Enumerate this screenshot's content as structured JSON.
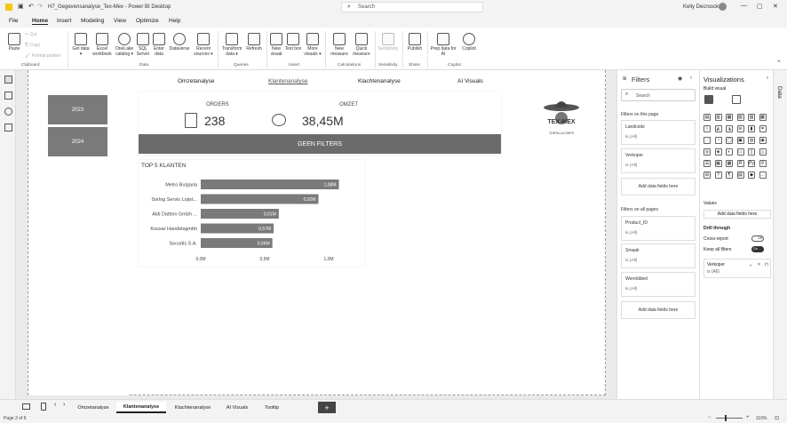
{
  "window": {
    "title": "H7_Gegevensanalyse_Tex-Mex - Power BI Desktop",
    "search_placeholder": "Search",
    "user": "Kelly Decroock"
  },
  "menu": [
    "File",
    "Home",
    "Insert",
    "Modeling",
    "View",
    "Optimize",
    "Help"
  ],
  "ribbon": {
    "clipboard": {
      "paste": "Paste",
      "cut": "Cut",
      "copy": "Copy",
      "format_painter": "Format painter",
      "group": "Clipboard"
    },
    "data": {
      "get_data": "Get data",
      "excel": "Excel workbook",
      "onelake": "OneLake catalog",
      "sql": "SQL Server",
      "enter": "Enter data",
      "dataverse": "Dataverse",
      "recent": "Recent sources",
      "group": "Data"
    },
    "queries": {
      "transform": "Transform data",
      "refresh": "Refresh",
      "group": "Queries"
    },
    "insert": {
      "new_visual": "New visual",
      "text_box": "Text box",
      "more_visuals": "More visuals",
      "group": "Insert"
    },
    "calculations": {
      "new_measure": "New measure",
      "quick_measure": "Quick measure",
      "group": "Calculations"
    },
    "sensitivity": {
      "label": "Sensitivity",
      "group": "Sensitivity"
    },
    "share": {
      "publish": "Publish",
      "group": "Share"
    },
    "copilot": {
      "prep": "Prep data for AI",
      "copilot": "Copilot",
      "group": "Copilot"
    }
  },
  "report": {
    "slicer_years": [
      "2023",
      "2024"
    ],
    "nav_tabs": [
      "Omzetanalyse",
      "Klantenanalyse",
      "Klachtenanalyse",
      "AI Visuals"
    ],
    "kpi": {
      "orders_label": "ORDERS",
      "orders_value": "238",
      "omzet_label": "OMZET",
      "omzet_value": "38,45M"
    },
    "geen_filters": "GEEN FILTERS",
    "logo_text": "TEX-MEX",
    "logo_sub": "TORTILLA CHIPS"
  },
  "chart_data": {
    "type": "bar",
    "title": "TOP 5 KLANTEN",
    "categories": [
      "Metro Bulgaria",
      "Sorlog Servis Lojist...",
      "Aldi Dattein Gmbh ...",
      "Kossar Handelsgmbh",
      "Socodis S.A."
    ],
    "values": [
      1.08,
      0.92,
      0.61,
      0.57,
      0.56
    ],
    "data_labels": [
      "1,08M",
      "0,92M",
      "0,61M",
      "0,57M",
      "0,56M"
    ],
    "x_ticks": [
      "0,0M",
      "0,5M",
      "1,0M"
    ],
    "xlim": [
      0,
      1.0
    ],
    "color": "#7a7a7a"
  },
  "filters": {
    "title": "Filters",
    "search_placeholder": "Search",
    "on_page_label": "Filters on this page",
    "on_page": [
      {
        "name": "Landcode",
        "state": "is (All)"
      },
      {
        "name": "Verkoper",
        "state": "is (All)"
      }
    ],
    "add_fields": "Add data fields here",
    "all_pages_label": "Filters on all pages",
    "all_pages": [
      {
        "name": "Product_ID",
        "state": "is (All)"
      },
      {
        "name": "Smaak",
        "state": "is (All)"
      },
      {
        "name": "Werelddeel",
        "state": "is (All)"
      }
    ]
  },
  "visualizations": {
    "title": "Visualizations",
    "build_visual": "Build visual",
    "values_label": "Values",
    "add_fields": "Add data fields here",
    "drill_through": "Drill through",
    "cross_report": "Cross-report",
    "cross_report_state": "Off",
    "keep_filters": "Keep all filters",
    "keep_filters_state": "On",
    "drill_field": "Verkoper",
    "drill_field_state": "is (All)"
  },
  "data_pane": {
    "label": "Data"
  },
  "page_tabs": [
    "Omzetanalyse",
    "Klantenanalyse",
    "Klachtenanalyse",
    "AI Visuals",
    "Tooltip"
  ],
  "active_tab": "Klantenanalyse",
  "status": {
    "page": "Page 2 of 6",
    "zoom": "110%"
  }
}
